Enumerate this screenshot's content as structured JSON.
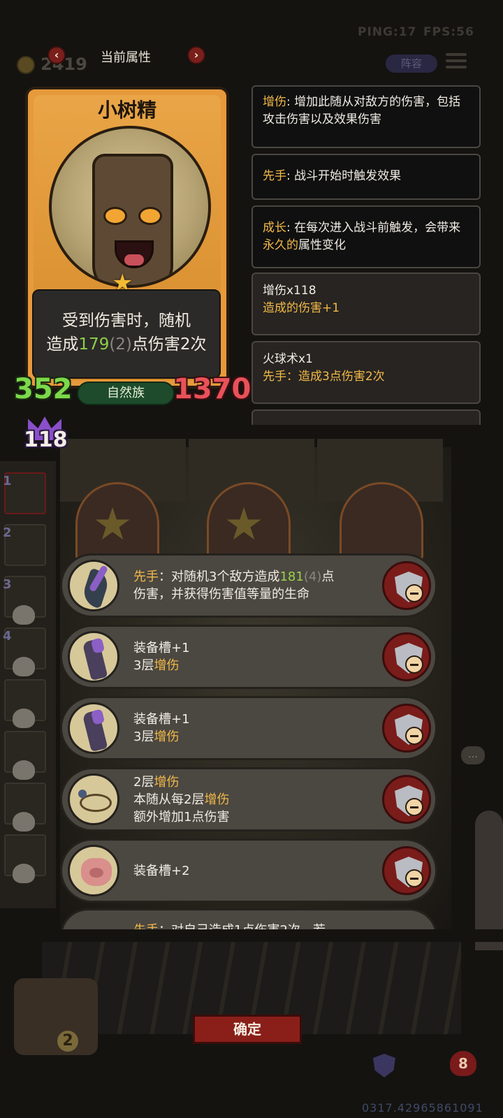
{
  "hud": {
    "ping": "PING:17",
    "fps": "FPS:56",
    "coins": "2419",
    "lineup": "阵容"
  },
  "nav": {
    "title": "当前属性",
    "prev": "‹",
    "next": "›"
  },
  "unit": {
    "name": "小树精",
    "desc_line1": "受到伤害时，随机",
    "desc_pre": "造成",
    "desc_value": "179",
    "desc_bonus": "(2)",
    "desc_post": "点伤害2次",
    "attack": "352",
    "health": "1370",
    "tribe": "自然族",
    "damage_bonus": "118",
    "stars": 1
  },
  "keywords": [
    {
      "key": "增伤",
      "text": ": 增加此随从对敌方的伤害，包括攻击伤害以及效果伤害"
    },
    {
      "key": "先手",
      "text": ": 战斗开始时触发效果"
    },
    {
      "key": "成长",
      "text_pre": ": 在每次进入战斗前触发，会带来",
      "hl": "永久的",
      "text_post": "属性变化"
    }
  ],
  "buffs": [
    {
      "title": "增伤x118",
      "sub": "造成的伤害+1"
    },
    {
      "title": "火球术x1",
      "sub": "先手：造成3点伤害2次"
    }
  ],
  "equipment": [
    {
      "icon": "dagger-icon",
      "pre_hl": "先手",
      "text1": "：对随机3个敌方造成",
      "value": "181",
      "bonus": "(4)",
      "text2": "点",
      "text3": "伤害，并获得伤害值等量的生命"
    },
    {
      "icon": "gauntlet-icon",
      "line1": "装备槽+1",
      "line2_pre": "3层",
      "line2_hl": "增伤"
    },
    {
      "icon": "gauntlet-icon",
      "line1": "装备槽+1",
      "line2_pre": "3层",
      "line2_hl": "增伤"
    },
    {
      "icon": "rope-icon",
      "line1_pre": "2层",
      "line1_hl": "增伤",
      "line2_pre": "本随从每2层",
      "line2_hl": "增伤",
      "line3": "额外增加1点伤害"
    },
    {
      "icon": "pig-icon",
      "line1": "装备槽+2"
    }
  ],
  "peek": {
    "hl": "先手",
    "text": "：对自己造成1点伤害2次，若"
  },
  "board": {
    "star_value": "1",
    "chest_value": "2",
    "heart_value": "8",
    "side_slots": [
      "1",
      "2",
      "3",
      "4"
    ]
  },
  "confirm": "确定",
  "build_id": "0317.42965861091",
  "colors": {
    "accent_gold": "#f2b948",
    "attack_green": "#7cd94a",
    "health_red": "#e8525a",
    "button_red": "#8a1f1a"
  }
}
